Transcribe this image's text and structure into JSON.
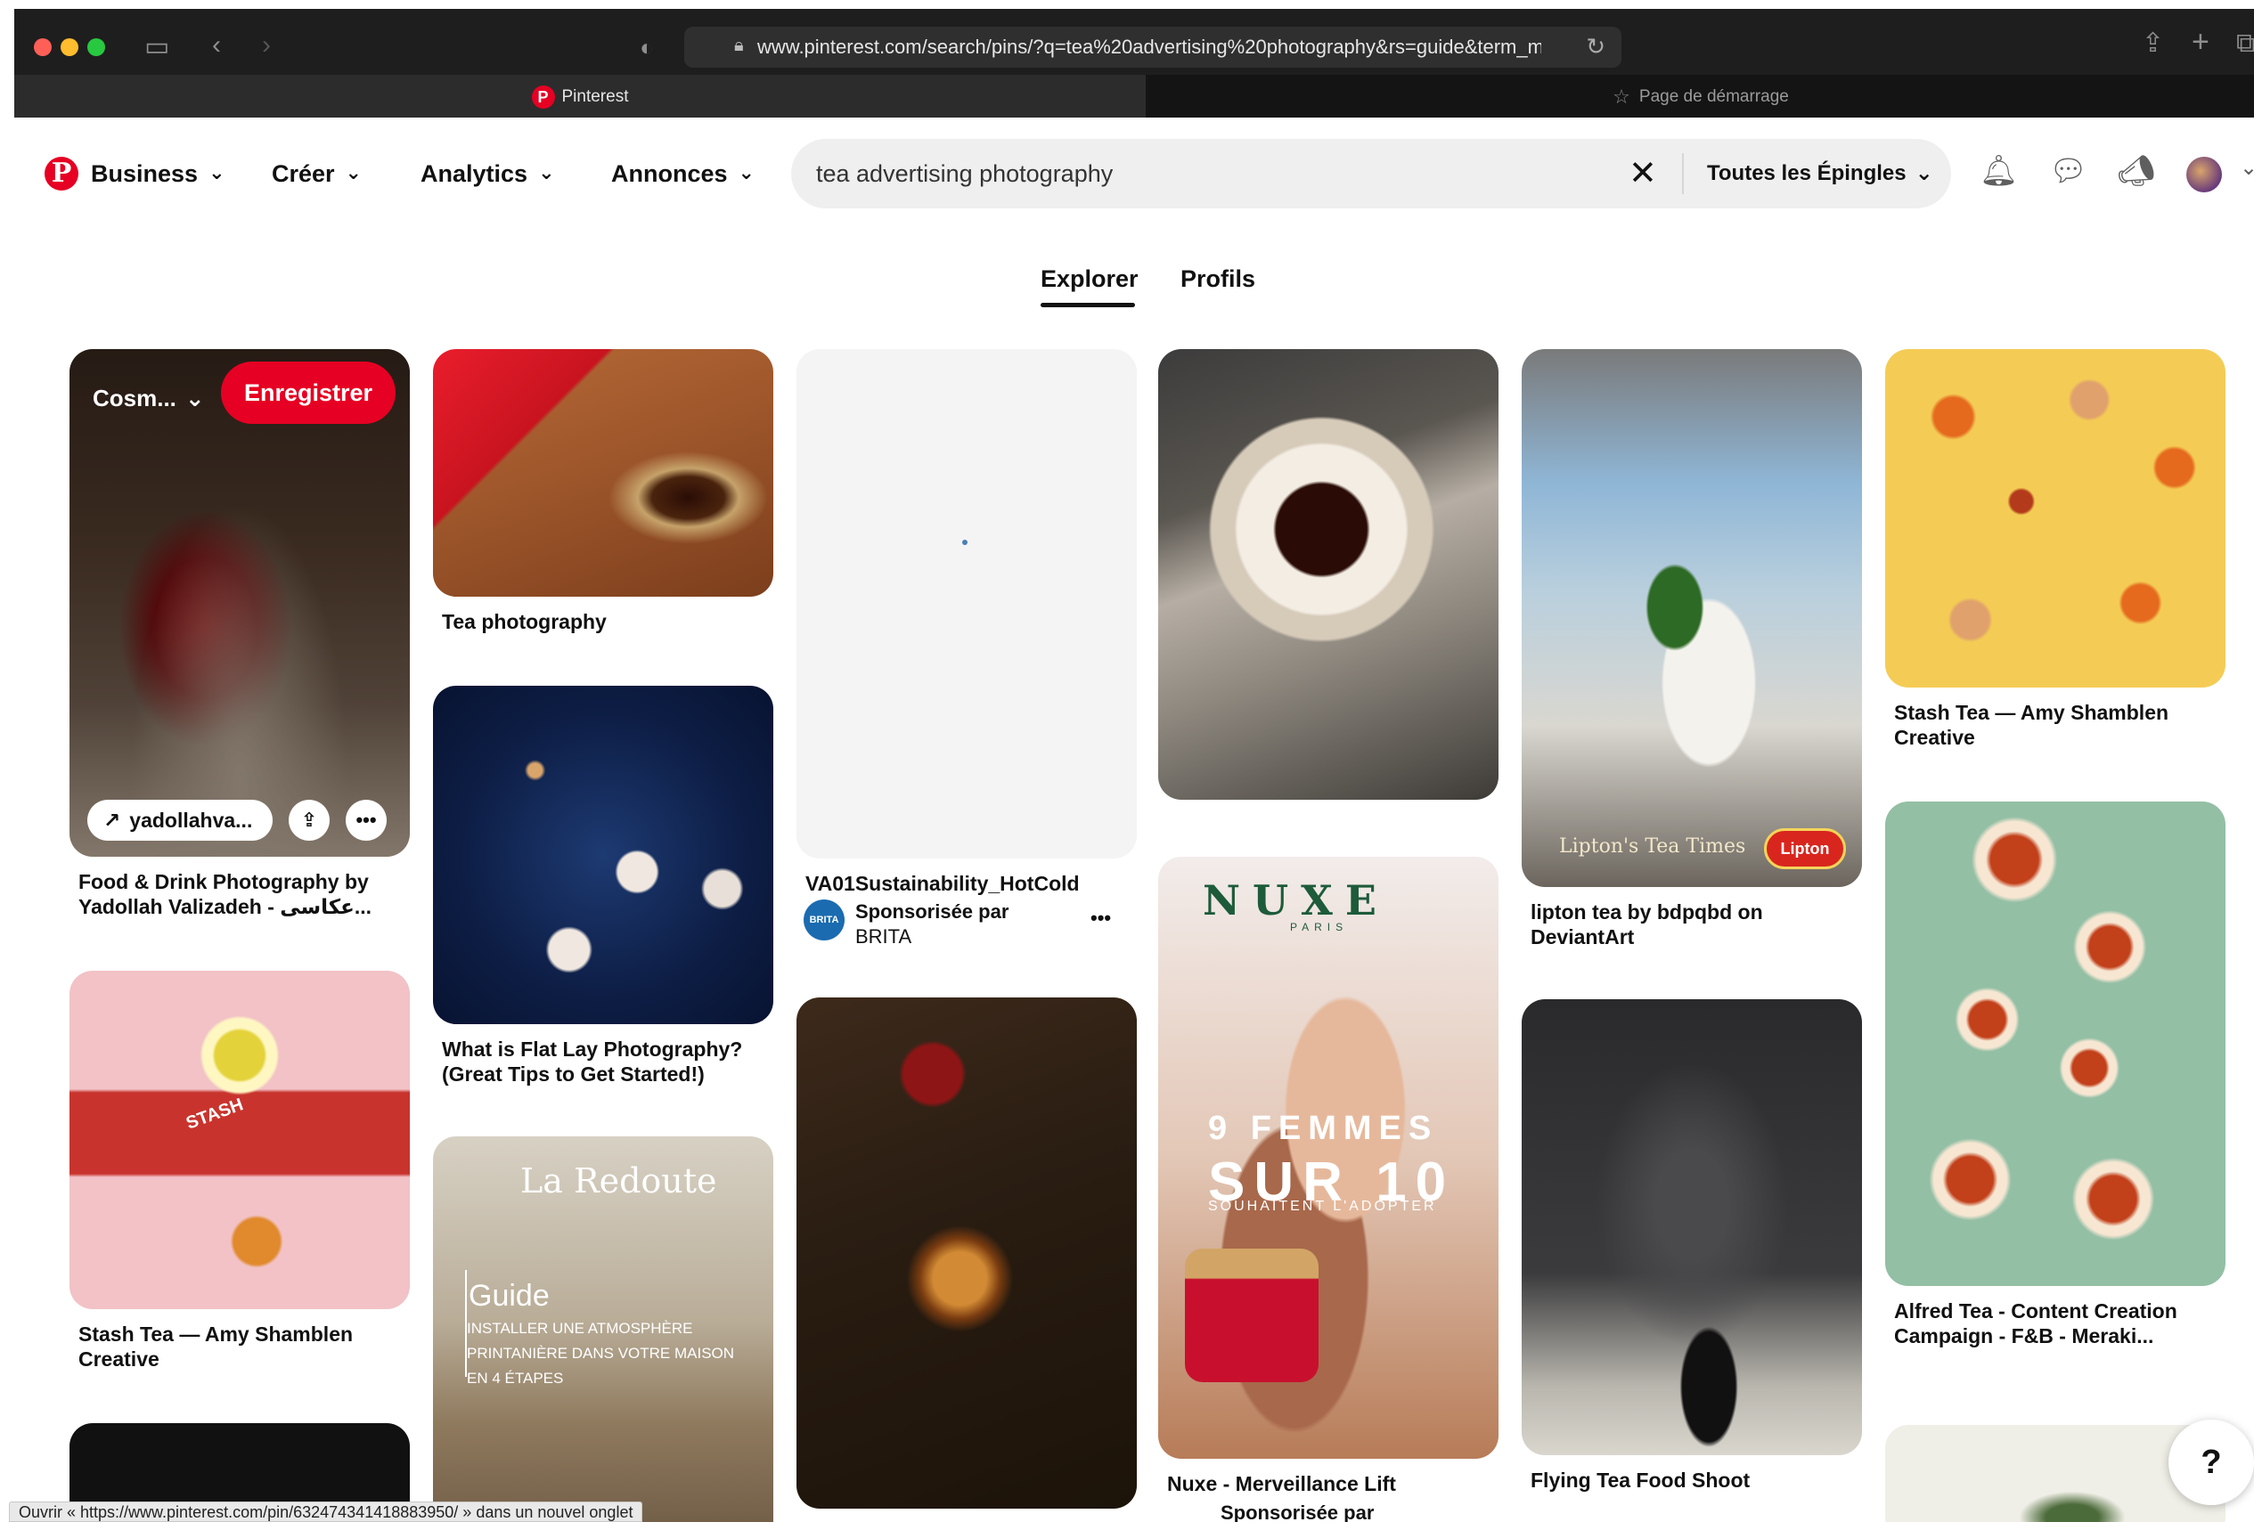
{
  "browser": {
    "url": "www.pinterest.com/search/pins/?q=tea%20advertising%20photography&rs=guide&term_meta",
    "tabs": [
      {
        "label": "Pinterest",
        "favicon": "P"
      },
      {
        "label": "Page de démarrage"
      }
    ],
    "status_url": "Ouvrir « https://www.pinterest.com/pin/632474341418883950/ » dans un nouvel onglet"
  },
  "header": {
    "logo": "P",
    "menus": [
      "Business",
      "Créer",
      "Analytics",
      "Annonces"
    ],
    "search": {
      "value": "tea advertising photography",
      "filter": "Toutes les Épingles"
    }
  },
  "tabs": {
    "explore": "Explorer",
    "profiles": "Profils"
  },
  "pins": {
    "food": {
      "board": "Cosm...",
      "save": "Enregistrer",
      "link": "yadollahva...",
      "title_line1": "Food & Drink Photography by",
      "title_line2": "Yadollah Valizadeh - عکاسی..."
    },
    "twinings": {
      "title": "Tea photography"
    },
    "flatlay": {
      "title_line1": "What is Flat Lay Photography?",
      "title_line2": "(Great Tips to Get Started!)"
    },
    "laredoute": {
      "brand": "La Redoute",
      "heading": "Guide",
      "line1": "INSTALLER UNE ATMOSPHÈRE",
      "line2": "PRINTANIÈRE DANS VOTRE MAISON",
      "line3": "EN 4 ÉTAPES"
    },
    "stash_pink": {
      "title_line1": "Stash Tea — Amy Shamblen",
      "title_line2": "Creative",
      "pack": "STASH"
    },
    "brita": {
      "title": "VA01Sustainability_HotCold",
      "sponsor_label": "Sponsorisée par",
      "sponsor": "BRITA",
      "logo": "BRITA"
    },
    "teacup": {},
    "nuxe": {
      "brand": "NUXE",
      "sub": "PARIS",
      "headline1": "9 FEMMES",
      "headline2": "SUR 10",
      "tagline": "SOUHAITENT L'ADOPTER",
      "title": "Nuxe - Merveillance Lift",
      "sponsor_label": "Sponsorisée par"
    },
    "lipton": {
      "caption": "Lipton's Tea Times",
      "brand": "Lipton",
      "title_line1": "lipton tea by bdpqbd on",
      "title_line2": "DeviantArt"
    },
    "flying": {
      "title": "Flying Tea Food Shoot"
    },
    "stash_yellow": {
      "title_line1": "Stash Tea — Amy Shamblen",
      "title_line2": "Creative"
    },
    "alfred": {
      "title_line1": "Alfred Tea - Content Creation",
      "title_line2": "Campaign - F&B - Meraki..."
    }
  },
  "help": "?"
}
